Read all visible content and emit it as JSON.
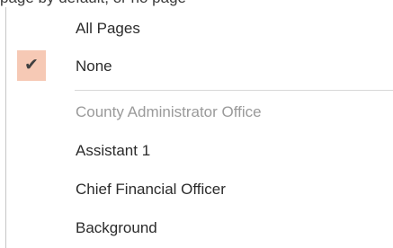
{
  "context": {
    "partial_text": "page by default, or no page"
  },
  "menu": {
    "items": [
      {
        "label": "All Pages",
        "checked": false,
        "disabled": false
      },
      {
        "label": "None",
        "checked": true,
        "disabled": false,
        "check_icon": "checkmark-icon",
        "check_glyph": "✔"
      }
    ],
    "section_header": "County Administrator Office",
    "section_items": [
      {
        "label": "Assistant 1"
      },
      {
        "label": "Chief Financial Officer"
      },
      {
        "label": "Background"
      }
    ]
  },
  "colors": {
    "checked_highlight": "#f6c9b5",
    "disabled_text": "#9a9a9a"
  }
}
